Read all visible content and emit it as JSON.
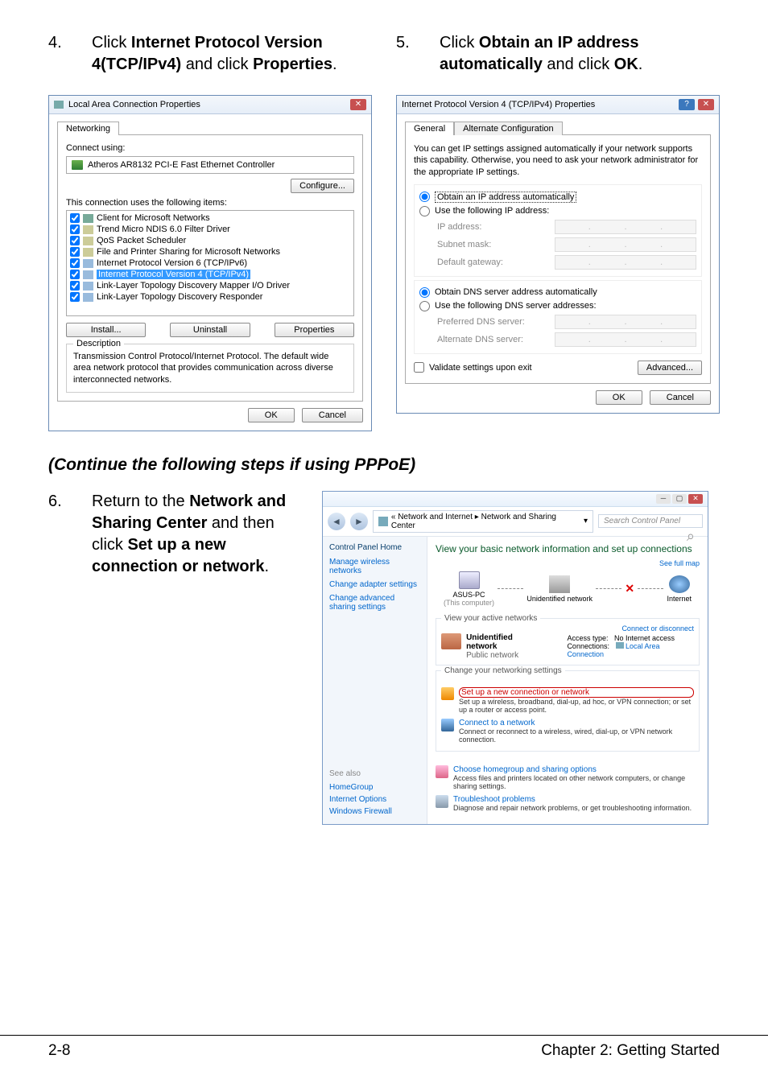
{
  "steps": {
    "s4": {
      "num": "4.",
      "pre": "Click ",
      "b1": "Internet Protocol Version 4(TCP/IPv4)",
      "mid": " and click ",
      "b2": "Properties",
      "post": "."
    },
    "s5": {
      "num": "5.",
      "pre": "Click ",
      "b1": "Obtain an IP address automatically",
      "mid": " and click ",
      "b2": "OK",
      "post": "."
    },
    "s6": {
      "num": "6.",
      "pre": "Return to the ",
      "b1": "Network and Sharing Center",
      "mid": " and then click ",
      "b2": "Set up a new connection or network",
      "post": "."
    }
  },
  "continue_heading": "(Continue the following steps if using PPPoE)",
  "lac": {
    "title": "Local Area Connection Properties",
    "tab": "Networking",
    "connect_using": "Connect using:",
    "adapter": "Atheros AR8132 PCI-E Fast Ethernet Controller",
    "configure": "Configure...",
    "uses_label": "This connection uses the following items:",
    "items": [
      "Client for Microsoft Networks",
      "Trend Micro NDIS 6.0 Filter Driver",
      "QoS Packet Scheduler",
      "File and Printer Sharing for Microsoft Networks",
      "Internet Protocol Version 6 (TCP/IPv6)",
      "Internet Protocol Version 4 (TCP/IPv4)",
      "Link-Layer Topology Discovery Mapper I/O Driver",
      "Link-Layer Topology Discovery Responder"
    ],
    "install": "Install...",
    "uninstall": "Uninstall",
    "properties": "Properties",
    "desc_label": "Description",
    "desc_text": "Transmission Control Protocol/Internet Protocol. The default wide area network protocol that provides communication across diverse interconnected networks.",
    "ok": "OK",
    "cancel": "Cancel"
  },
  "ipv4": {
    "title": "Internet Protocol Version 4 (TCP/IPv4) Properties",
    "tab_general": "General",
    "tab_alt": "Alternate Configuration",
    "intro": "You can get IP settings assigned automatically if your network supports this capability. Otherwise, you need to ask your network administrator for the appropriate IP settings.",
    "r_auto_ip": "Obtain an IP address automatically",
    "r_use_ip": "Use the following IP address:",
    "ip": "IP address:",
    "subnet": "Subnet mask:",
    "gateway": "Default gateway:",
    "r_auto_dns": "Obtain DNS server address automatically",
    "r_use_dns": "Use the following DNS server addresses:",
    "pref_dns": "Preferred DNS server:",
    "alt_dns": "Alternate DNS server:",
    "validate": "Validate settings upon exit",
    "advanced": "Advanced...",
    "ok": "OK",
    "cancel": "Cancel"
  },
  "nsc": {
    "breadcrumb_pre": "« Network and Internet ▸ Network and Sharing Center",
    "search_ph": "Search Control Panel",
    "side_home": "Control Panel Home",
    "side_wireless": "Manage wireless networks",
    "side_adapter": "Change adapter settings",
    "side_sharing": "Change advanced sharing settings",
    "heading": "View your basic network information and set up connections",
    "see_full": "See full map",
    "node_pc": "ASUS-PC",
    "node_pc_sub": "(This computer)",
    "node_unid": "Unidentified network",
    "node_inet": "Internet",
    "active_label": "View your active networks",
    "conn_disc": "Connect or disconnect",
    "unid_net": "Unidentified network",
    "public_net": "Public network",
    "access_type": "Access type:",
    "no_internet": "No Internet access",
    "connections": "Connections:",
    "lac_link": "Local Area Connection",
    "change_label": "Change your networking settings",
    "l1t": "Set up a new connection or network",
    "l1d": "Set up a wireless, broadband, dial-up, ad hoc, or VPN connection; or set up a router or access point.",
    "l2t": "Connect to a network",
    "l2d": "Connect or reconnect to a wireless, wired, dial-up, or VPN network connection.",
    "l3t": "Choose homegroup and sharing options",
    "l3d": "Access files and printers located on other network computers, or change sharing settings.",
    "l4t": "Troubleshoot problems",
    "l4d": "Diagnose and repair network problems, or get troubleshooting information.",
    "seealso": "See also",
    "homegroup": "HomeGroup",
    "inetopt": "Internet Options",
    "winfw": "Windows Firewall"
  },
  "footer": {
    "left": "2-8",
    "right": "Chapter 2: Getting Started"
  }
}
